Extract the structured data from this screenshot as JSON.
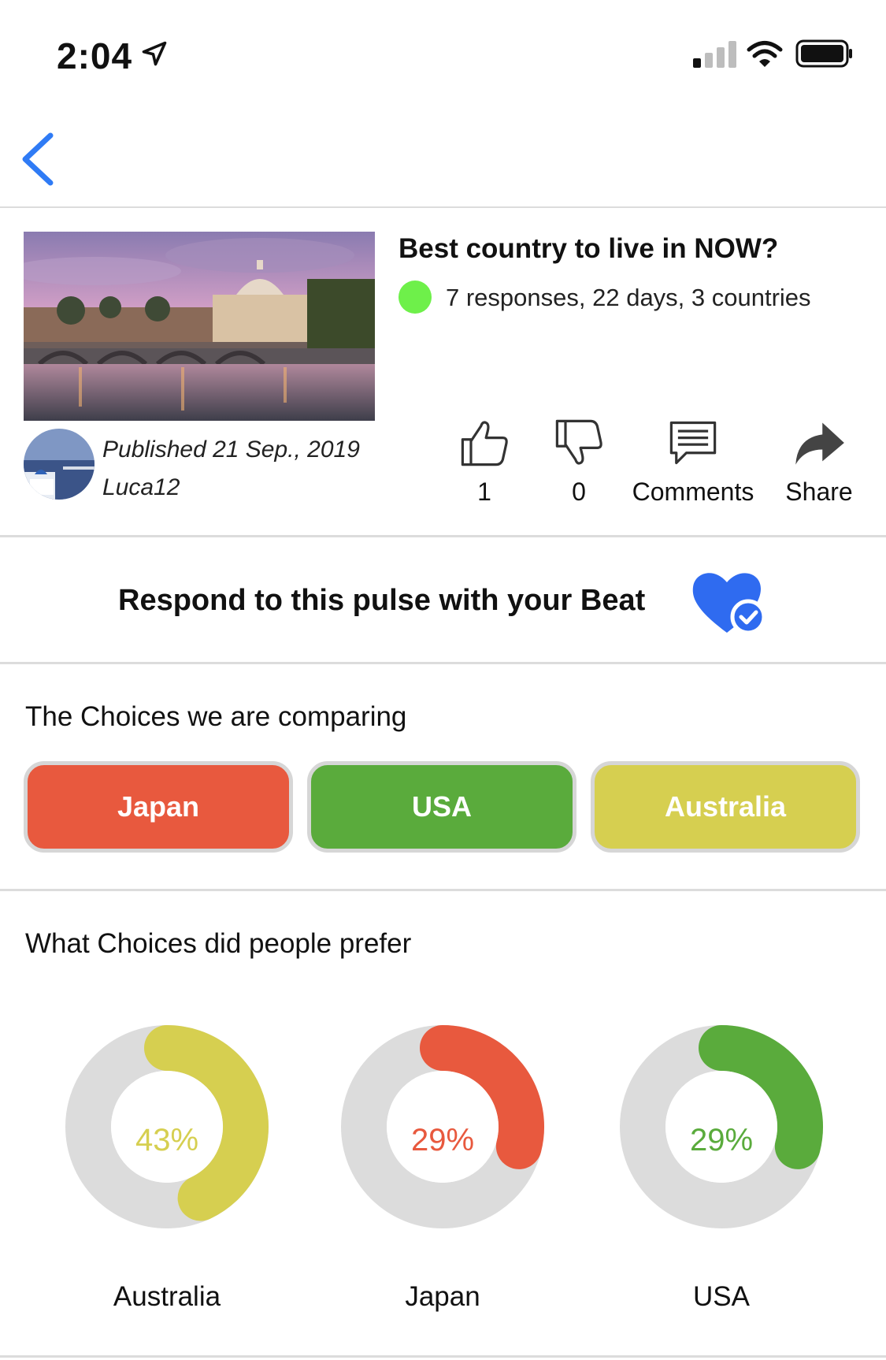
{
  "status_bar": {
    "time": "2:04",
    "icons": [
      "location-arrow-icon",
      "cellular-signal-icon",
      "wifi-icon",
      "battery-icon"
    ]
  },
  "nav": {
    "back_icon": "chevron-left-icon",
    "accent": "#2f7bf5"
  },
  "post": {
    "title": "Best country to live in NOW?",
    "status_color": "#6ef04a",
    "meta": "7 responses, 22 days, 3 countries",
    "published": "Published 21 Sep., 2019",
    "author": "Luca12",
    "actions": {
      "like_count": "1",
      "dislike_count": "0",
      "comments_label": "Comments",
      "share_label": "Share"
    }
  },
  "respond": {
    "text": "Respond to this pulse with your Beat",
    "icon": "heart-check-icon"
  },
  "choices": {
    "title": "The Choices we are comparing",
    "items": [
      {
        "label": "Japan",
        "color": "#e8593e"
      },
      {
        "label": "USA",
        "color": "#5aab3c"
      },
      {
        "label": "Australia",
        "color": "#d6cf50"
      }
    ]
  },
  "results": {
    "title": "What Choices did people prefer",
    "items": [
      {
        "label": "Australia",
        "percent_text": "43%",
        "color": "#d6cf50"
      },
      {
        "label": "Japan",
        "percent_text": "29%",
        "color": "#e8593e"
      },
      {
        "label": "USA",
        "percent_text": "29%",
        "color": "#5aab3c"
      }
    ]
  },
  "chart_data": {
    "type": "pie",
    "categories": [
      "Australia",
      "Japan",
      "USA"
    ],
    "values": [
      43,
      29,
      29
    ],
    "title": "What Choices did people prefer",
    "unit": "%"
  }
}
